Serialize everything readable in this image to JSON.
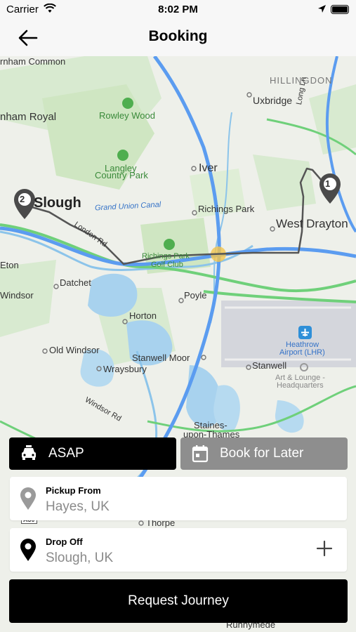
{
  "status_bar": {
    "carrier": "Carrier",
    "time": "8:02 PM",
    "icons": [
      "wifi-icon",
      "location-arrow-icon",
      "battery-icon"
    ]
  },
  "nav": {
    "title": "Booking",
    "back_icon": "arrow-left-icon"
  },
  "map": {
    "labels": {
      "burnham_common": "rnham Common",
      "burnham_royal": "nham Royal",
      "rowley_wood": "Rowley Wood",
      "langley_country_park_1": "Langley",
      "langley_country_park_2": "Country Park",
      "iver": "Iver",
      "uxbridge": "Uxbridge",
      "hillingdon": "HILLINGDON",
      "long_ln": "Long Ln",
      "slough": "Slough",
      "grand_union_canal": "Grand Union Canal",
      "richings_park": "Richings Park",
      "west_drayton": "West Drayton",
      "london_rd": "London Rd",
      "richings_park_golf_1": "Richings Park",
      "richings_park_golf_2": "Golf Club",
      "eton": "Eton",
      "datchet": "Datchet",
      "windsor": "Windsor",
      "poyle": "Poyle",
      "horton": "Horton",
      "old_windsor": "Old Windsor",
      "stanwell_moor": "Stanwell Moor",
      "wraysbury": "Wraysbury",
      "stanwell": "Stanwell",
      "heathrow_1": "Heathrow",
      "heathrow_2": "Airport (LHR)",
      "art_lounge_1": "Art & Lounge -",
      "art_lounge_2": "Headquarters",
      "windsor_rd": "Windsor Rd",
      "staines_1": "Staines-",
      "staines_2": "upon-Thames",
      "thorpe": "Thorpe",
      "runnymede": "Runnymede",
      "road_a30": "A30"
    },
    "markers": [
      {
        "number": "1",
        "place": "pickup"
      },
      {
        "number": "2",
        "place": "dropoff"
      }
    ],
    "colors": {
      "route": "#555555",
      "motorway": "#5b9cf0",
      "a_road": "#6fd07a",
      "water": "#a8d2ee",
      "park": "#cfe6c2"
    }
  },
  "timing": {
    "asap_label": "ASAP",
    "asap_icon": "car-icon",
    "later_label": "Book for Later",
    "later_icon": "calendar-icon",
    "selected": "ASAP"
  },
  "pickup": {
    "label": "Pickup From",
    "value": "Hayes, UK",
    "icon": "map-pin-icon"
  },
  "dropoff": {
    "label": "Drop Off",
    "value": "Slough, UK",
    "icon": "map-pin-icon",
    "add_icon": "plus-icon"
  },
  "request_button": "Request Journey"
}
